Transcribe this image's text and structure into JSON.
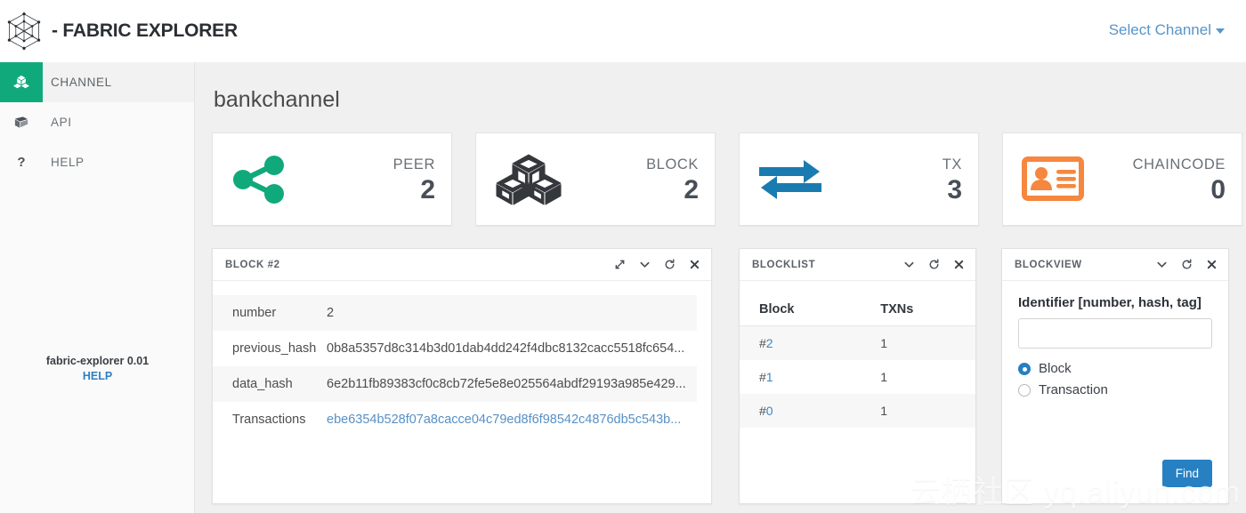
{
  "header": {
    "logo_icon": "hexagon-network-icon",
    "brand_title": "- FABRIC EXPLORER",
    "select_channel_label": "Select Channel"
  },
  "sidebar": {
    "items": [
      {
        "label": "CHANNEL",
        "icon": "cubes-icon",
        "active": true
      },
      {
        "label": "API",
        "icon": "book-icon",
        "active": false
      },
      {
        "label": "HELP",
        "icon": "question-mark-icon",
        "active": false
      }
    ],
    "footer_version": "fabric-explorer 0.01",
    "footer_help_label": "HELP"
  },
  "main": {
    "page_title": "bankchannel",
    "stats": [
      {
        "caption": "PEER",
        "value": "2",
        "icon": "share-nodes-icon",
        "color": "#10a97c"
      },
      {
        "caption": "BLOCK",
        "value": "2",
        "icon": "cubes-3d-icon",
        "color": "#34383c"
      },
      {
        "caption": "TX",
        "value": "3",
        "icon": "exchange-arrows-icon",
        "color": "#1a7bb0"
      },
      {
        "caption": "CHAINCODE",
        "value": "0",
        "icon": "id-card-icon",
        "color": "#f5873f"
      }
    ],
    "block_panel": {
      "title": "BLOCK #2",
      "tools": [
        "expand-icon",
        "chevron-down-icon",
        "refresh-icon",
        "close-icon"
      ],
      "rows": [
        {
          "key": "number",
          "value": "2",
          "link": false
        },
        {
          "key": "previous_hash",
          "value": "0b8a5357d8c314b3d01dab4dd242f4dbc8132cacc5518fc654...",
          "link": false
        },
        {
          "key": "data_hash",
          "value": "6e2b11fb89383cf0c8cb72fe5e8e025564abdf29193a985e429...",
          "link": false
        },
        {
          "key": "Transactions",
          "value": "ebe6354b528f07a8cacce04c79ed8f6f98542c4876db5c543b...",
          "link": true
        }
      ]
    },
    "blocklist_panel": {
      "title": "BLOCKLIST",
      "tools": [
        "chevron-down-icon",
        "refresh-icon",
        "close-icon"
      ],
      "columns": [
        "Block",
        "TXNs"
      ],
      "rows": [
        {
          "block": "2",
          "txns": "1"
        },
        {
          "block": "1",
          "txns": "1"
        },
        {
          "block": "0",
          "txns": "1"
        }
      ]
    },
    "blockview_panel": {
      "title": "BLOCKVIEW",
      "tools": [
        "chevron-down-icon",
        "refresh-icon",
        "close-icon"
      ],
      "identifier_label": "Identifier [number, hash, tag]",
      "identifier_value": "",
      "identifier_placeholder": "",
      "radio_block_label": "Block",
      "radio_transaction_label": "Transaction",
      "selected_radio": "Block",
      "find_label": "Find"
    }
  },
  "watermark": "云栖社区 yq.aliyun.com",
  "colors": {
    "accent_green": "#10a97c",
    "link_blue": "#3a86c8",
    "button_blue": "#2680c2",
    "orange": "#f5873f",
    "tx_blue": "#1a7bb0"
  }
}
